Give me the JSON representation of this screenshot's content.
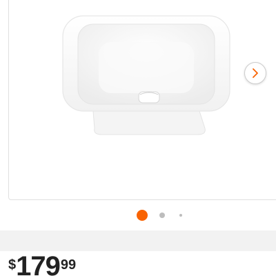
{
  "product_gallery": {
    "image": {
      "name": "square-white-sink-image"
    },
    "next_button": {
      "icon": "chevron-right-icon",
      "color": "#f96302"
    },
    "pagination": {
      "total": 3,
      "active_index": 1,
      "active_color": "#f96302",
      "inactive_color": "#bdbdbd"
    }
  },
  "pricing": {
    "currency_symbol": "$",
    "dollars": "179",
    "cents": "99"
  }
}
